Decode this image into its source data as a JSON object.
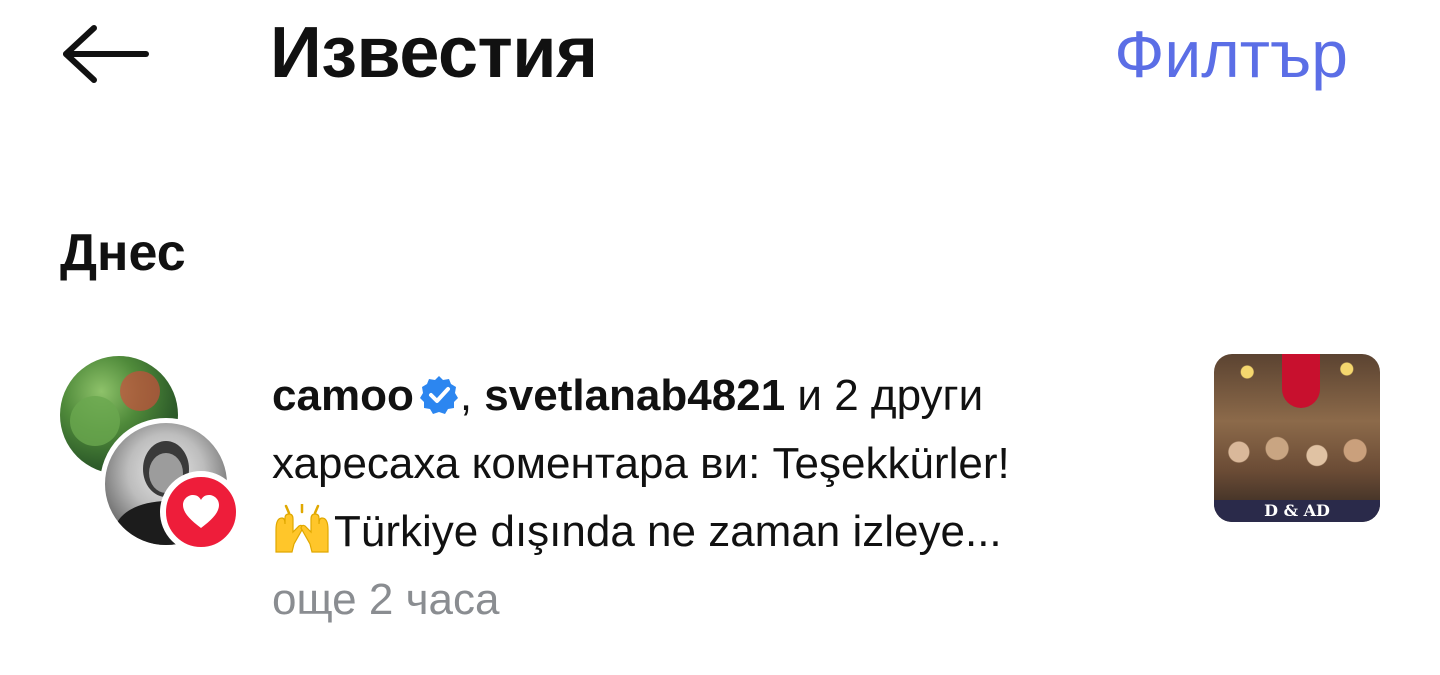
{
  "header": {
    "back_icon": "arrow-left-icon",
    "title": "Известия",
    "filter_label": "Филтър",
    "filter_color": "#5b6ee6"
  },
  "sections": [
    {
      "title": "Днес",
      "notifications": [
        {
          "users": [
            "camoo",
            "svetlanab4821"
          ],
          "verified_icon": "verified-badge-icon",
          "separator": ",",
          "others_text": "и 2 други",
          "action_text": "харесаха коментара ви: Teşekkürler!",
          "emoji_icon": "raising-hands-emoji-icon",
          "comment_text": "Türkiye dışında ne zaman izleye...",
          "time": "още 2 часа",
          "badge_icon": "heart-icon",
          "badge_color": "#ee1d3a",
          "thumbnail_caption": "D & AD"
        }
      ]
    }
  ]
}
